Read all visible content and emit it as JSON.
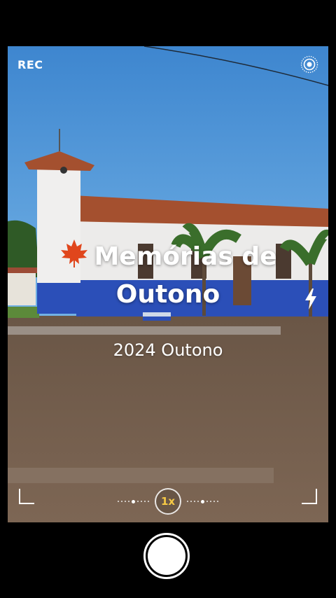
{
  "recording_label": "REC",
  "title": {
    "leaf_icon": "maple-leaf-icon",
    "line1": "Memórias de",
    "line2": "Outono"
  },
  "subtitle": "2024 Outono",
  "zoom_label": "1x",
  "icons": {
    "live": "live-photo-icon",
    "flash": "flash-icon"
  },
  "colors": {
    "zoom_text": "#f6c945",
    "leaf": "#e0461c"
  }
}
